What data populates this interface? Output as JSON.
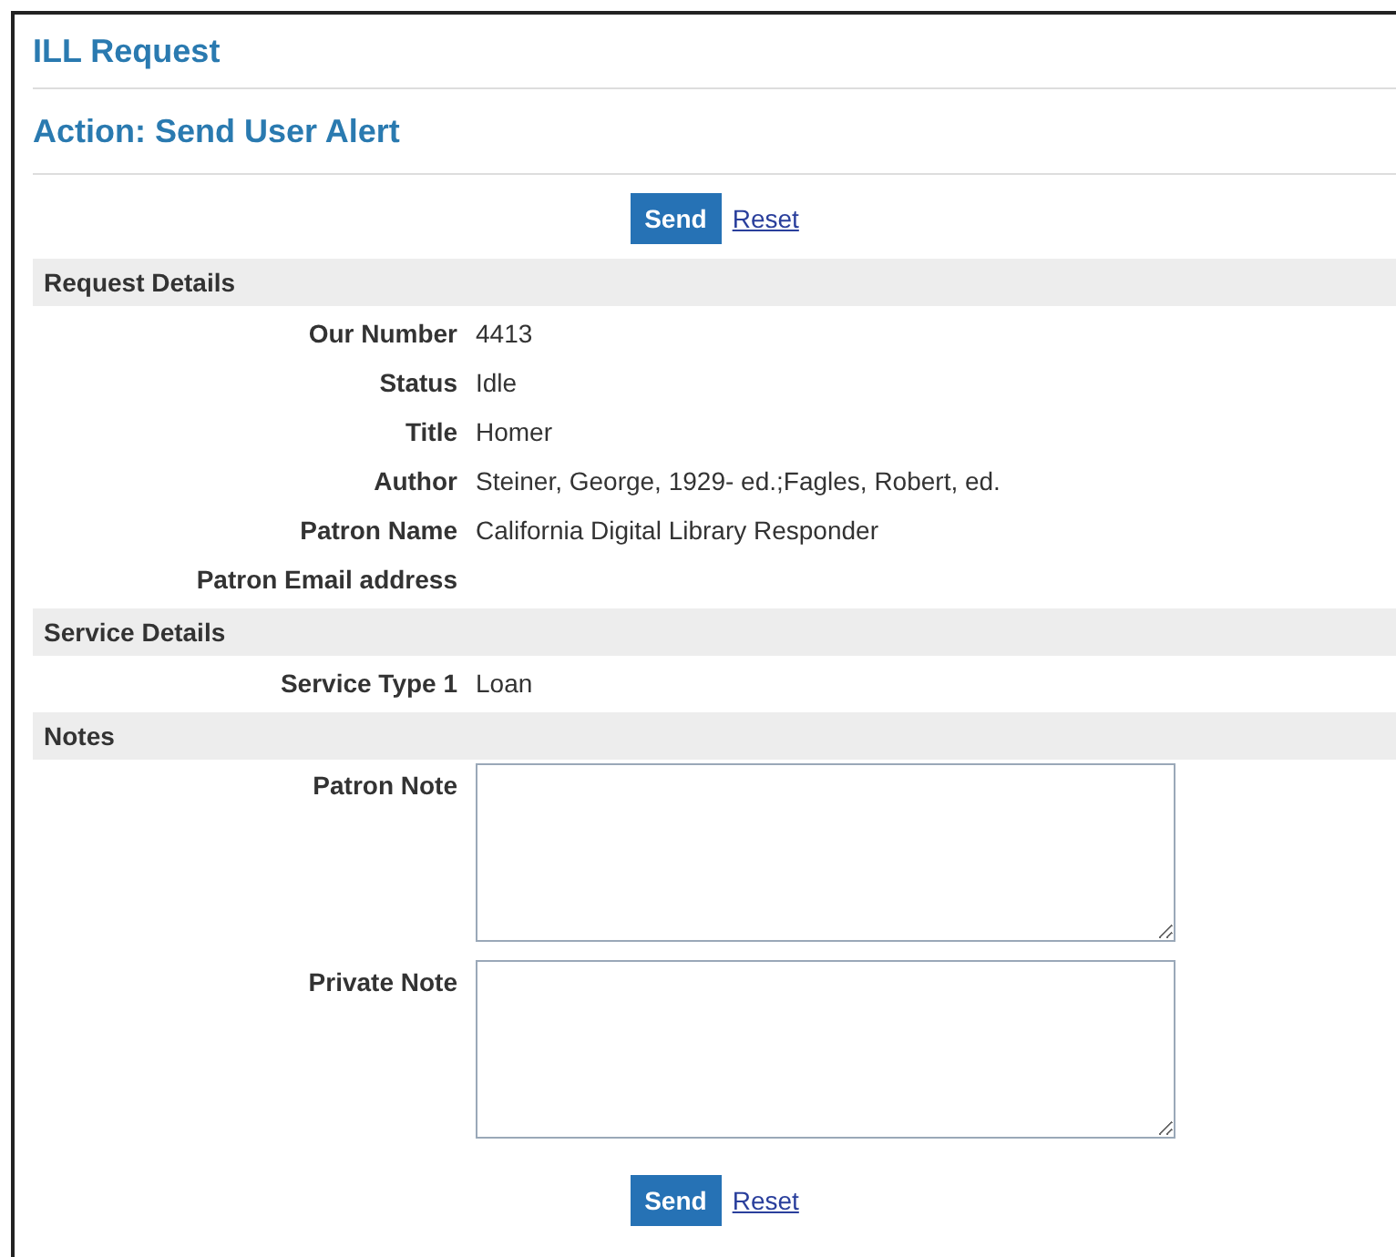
{
  "page_title": "ILL Request",
  "action_title": "Action: Send User Alert",
  "top_actions": {
    "send": "Send",
    "reset": "Reset"
  },
  "sections": [
    {
      "kind": "fields",
      "title": "Request Details",
      "rows": [
        {
          "label": "Our Number",
          "value": "4413"
        },
        {
          "label": "Status",
          "value": "Idle"
        },
        {
          "label": "Title",
          "value": "Homer"
        },
        {
          "label": "Author",
          "value": "Steiner, George, 1929- ed.;Fagles, Robert, ed."
        },
        {
          "label": "Patron Name",
          "value": "California Digital Library Responder"
        },
        {
          "label": "Patron Email address"
        }
      ]
    },
    {
      "kind": "fields",
      "title": "Service Details",
      "rows": [
        {
          "label": "Service Type 1",
          "value": "Loan"
        }
      ]
    },
    {
      "kind": "notes",
      "title": "Notes",
      "rows": [
        {
          "label": "Patron Note"
        },
        {
          "label": "Private Note"
        }
      ]
    }
  ],
  "bottom_actions": {
    "send": "Send",
    "reset": "Reset"
  }
}
